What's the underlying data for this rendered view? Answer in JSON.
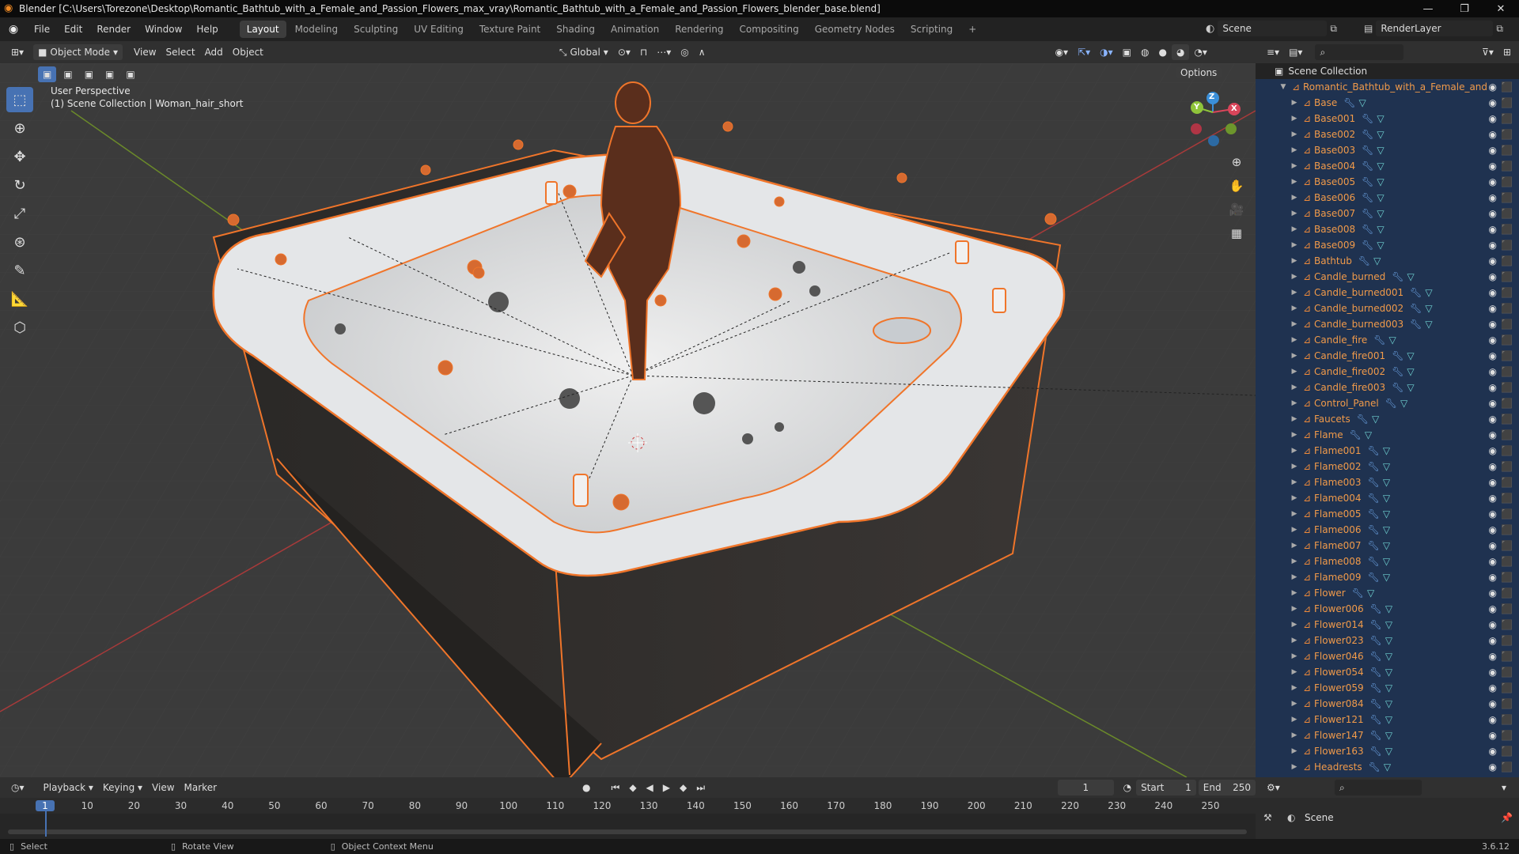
{
  "app": {
    "title": "Blender [C:\\Users\\Torezone\\Desktop\\Romantic_Bathtub_with_a_Female_and_Passion_Flowers_max_vray\\Romantic_Bathtub_with_a_Female_and_Passion_Flowers_blender_base.blend]",
    "version": "3.6.12"
  },
  "menu": [
    "File",
    "Edit",
    "Render",
    "Window",
    "Help"
  ],
  "workspaces": [
    "Layout",
    "Modeling",
    "Sculpting",
    "UV Editing",
    "Texture Paint",
    "Shading",
    "Animation",
    "Rendering",
    "Compositing",
    "Geometry Nodes",
    "Scripting"
  ],
  "active_workspace": "Layout",
  "scene": {
    "label": "Scene",
    "render_layer": "RenderLayer"
  },
  "viewport_header": {
    "mode": "Object Mode",
    "items": [
      "View",
      "Select",
      "Add",
      "Object"
    ],
    "transform": "Global",
    "options": "Options"
  },
  "viewport": {
    "perspective": "User Perspective",
    "collection_info": "(1) Scene Collection | Woman_hair_short",
    "gizmo_labels": {
      "x": "X",
      "y": "Y",
      "z": "Z"
    }
  },
  "outliner": {
    "root": "Scene Collection",
    "collection": "Romantic_Bathtub_with_a_Female_and",
    "objects": [
      "Base",
      "Base001",
      "Base002",
      "Base003",
      "Base004",
      "Base005",
      "Base006",
      "Base007",
      "Base008",
      "Base009",
      "Bathtub",
      "Candle_burned",
      "Candle_burned001",
      "Candle_burned002",
      "Candle_burned003",
      "Candle_fire",
      "Candle_fire001",
      "Candle_fire002",
      "Candle_fire003",
      "Control_Panel",
      "Faucets",
      "Flame",
      "Flame001",
      "Flame002",
      "Flame003",
      "Flame004",
      "Flame005",
      "Flame006",
      "Flame007",
      "Flame008",
      "Flame009",
      "Flower",
      "Flower006",
      "Flower014",
      "Flower023",
      "Flower046",
      "Flower054",
      "Flower059",
      "Flower084",
      "Flower121",
      "Flower147",
      "Flower163",
      "Headrests"
    ]
  },
  "timeline": {
    "menus": [
      "Playback",
      "Keying",
      "View",
      "Marker"
    ],
    "current_frame": "1",
    "start_label": "Start",
    "start": "1",
    "end_label": "End",
    "end": "250",
    "ticks": [
      "1",
      "10",
      "20",
      "30",
      "40",
      "50",
      "60",
      "70",
      "80",
      "90",
      "100",
      "110",
      "120",
      "130",
      "140",
      "150",
      "160",
      "170",
      "180",
      "190",
      "200",
      "210",
      "220",
      "230",
      "240",
      "250"
    ]
  },
  "properties": {
    "scene": "Scene"
  },
  "status": {
    "select": "Select",
    "rotate": "Rotate View",
    "context": "Object Context Menu"
  },
  "colors": {
    "accent": "#4772b3",
    "selection": "#f0752a",
    "outliner_bg": "#1f3250",
    "x_axis": "#d9455a",
    "y_axis": "#8fc43a",
    "z_axis": "#3a8fd9"
  }
}
